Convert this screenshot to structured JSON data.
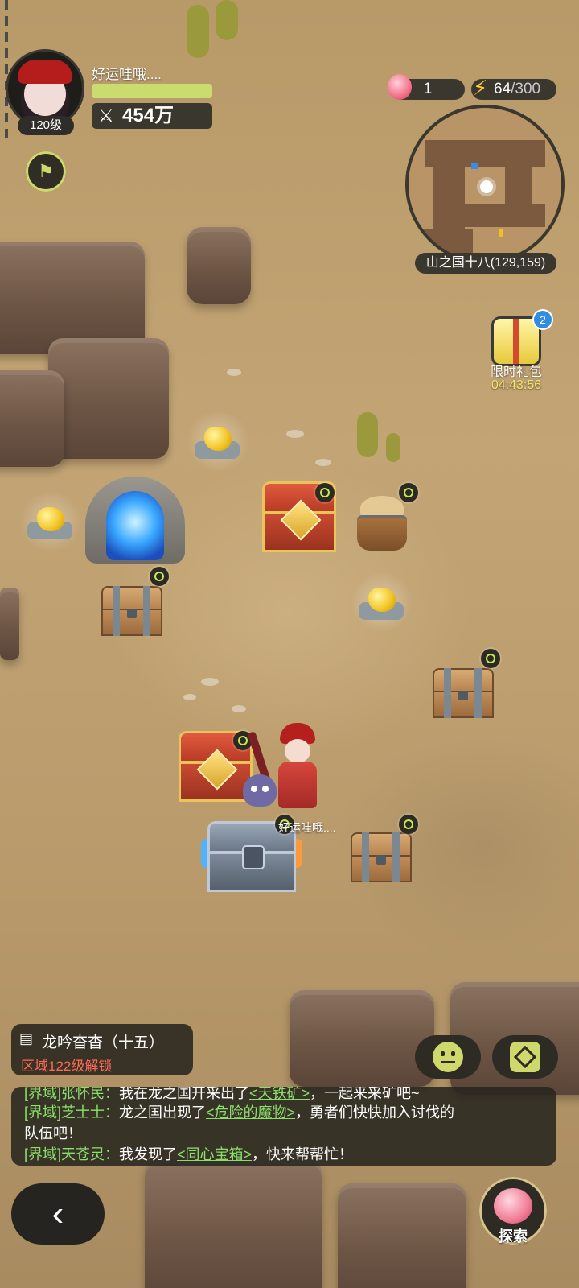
{
  "player": {
    "name": "好运哇哦....",
    "level": "120级",
    "hp_fraction": 1.0,
    "power": "454万",
    "power_icon": "crossed-swords-icon"
  },
  "resources": {
    "apple_count": "1",
    "energy_current": "64",
    "energy_max": "/300"
  },
  "minimap": {
    "location": "山之国十八(129,159)"
  },
  "gift": {
    "label": "限时礼包",
    "timer": "04:43:56",
    "badge": "2"
  },
  "map_objects": {
    "hero_name": "好运哇哦...."
  },
  "quest": {
    "title": "龙吟杳杳（十五）",
    "subtitle": "区域122级解锁"
  },
  "chat": {
    "lines": [
      {
        "channel": "[界域]",
        "sender": "张怀民：",
        "text": "我在龙之国开采出了",
        "link": "<天铁矿>",
        "tail": "，一起来采矿吧~"
      },
      {
        "channel": "[界域]",
        "sender": "芝士士：",
        "text": "龙之国出现了",
        "link": "<危险的魔物>",
        "tail": "，勇者们快快加入讨伐的"
      },
      {
        "channel": "",
        "sender": "",
        "text": "队伍吧！",
        "link": "",
        "tail": ""
      },
      {
        "channel": "[界域]",
        "sender": "天苍灵：",
        "text": "我发现了",
        "link": "<同心宝箱>",
        "tail": "，快来帮帮忙！"
      }
    ]
  },
  "buttons": {
    "back": "‹",
    "explore": "探索"
  },
  "colors": {
    "accent": "#cfd86a",
    "chat_link": "#8be06b",
    "warning": "#ff6a55",
    "gift_timer": "#f2e36a"
  }
}
